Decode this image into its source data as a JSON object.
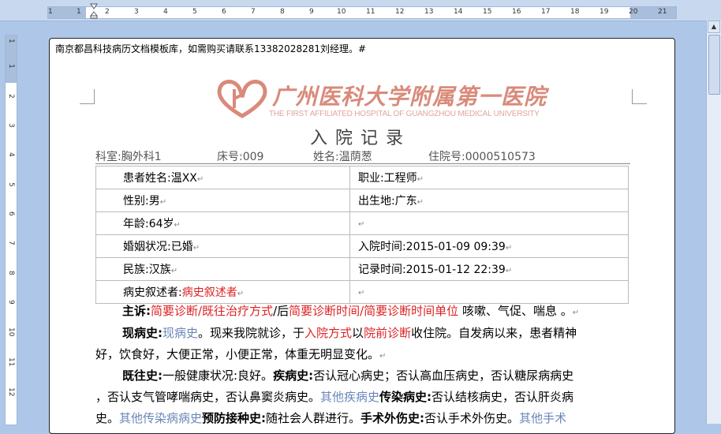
{
  "ruler": {
    "h_numbers": [
      "1",
      "1",
      "2",
      "3",
      "4",
      "5",
      "6",
      "7",
      "8",
      "9",
      "10",
      "11",
      "12",
      "13",
      "14",
      "15",
      "16",
      "17",
      "18",
      "19",
      "20",
      "21"
    ],
    "v_numbers": [
      "1",
      "1",
      "2",
      "3",
      "4",
      "5",
      "6",
      "7",
      "8",
      "9",
      "10",
      "11",
      "12"
    ]
  },
  "document": {
    "header_note": "南京都昌科技病历文档模板库，如需购买请联系13382028281刘经理。#",
    "logo_cn": "广州医科大学附属第一医院",
    "logo_en": "THE FIRST AFFILIATED HOSPITAL OF GUANGZHOU MEDICAL UNIVERSITY",
    "title": "入院记录",
    "info": {
      "dept": "科室:胸外科1",
      "bed": "床号:009",
      "name": "姓名:温荫葱",
      "admission_no": "住院号:0000510573"
    },
    "table": {
      "name": "患者姓名:温XX",
      "job": "职业:工程师",
      "sex": "性别:男",
      "birthplace": "出生地:广东",
      "age": "年龄:64岁",
      "blank1": "",
      "marital": "婚姻状况:已婚",
      "admit_time": "入院时间:2015-01-09 09:39",
      "ethnic": "民族:汉族",
      "record_time": "记录时间:2015-01-12 22:39",
      "narrator_label": "病史叙述者:",
      "narrator_value": "病史叙述者",
      "blank2": ""
    },
    "complaint": {
      "label": "主诉:",
      "field1": "简要诊断/既往治疗方式",
      "sep": "/后",
      "field2": "简要诊断时间/简要诊断时间单位",
      "text": "咳嗽、气促、喘息",
      "end": "。"
    },
    "present": {
      "label": "现病史:",
      "field1": "现病史",
      "text1": "。现来我院就诊，于",
      "field2": "入院方式",
      "text2": "以",
      "field3": "院前诊断",
      "text3": "收住院。自发病以来，患者精神",
      "line2": "好，饮食好，大便正常，小便正常，体重无明显变化。"
    },
    "past": {
      "label": "既往史:",
      "t1": "一般健康状况:良好。",
      "l2": "疾病史:",
      "t2": "否认冠心病史；否认高血压病史，否认糖尿病病史",
      "line2a": "，否认支气管哮喘病史，否认鼻窦炎病史。",
      "field1": "其他疾病史",
      "l3": "传染病史:",
      "t3": "否认结核病史，否认肝炎病",
      "line3a": "史。",
      "field2": "其他传染病病史",
      "l4": "预防接种史:",
      "t4": "随社会人群进行。",
      "l5": "手术外伤史:",
      "t5": "否认手术外伤史。",
      "field3": "其他手术"
    }
  }
}
